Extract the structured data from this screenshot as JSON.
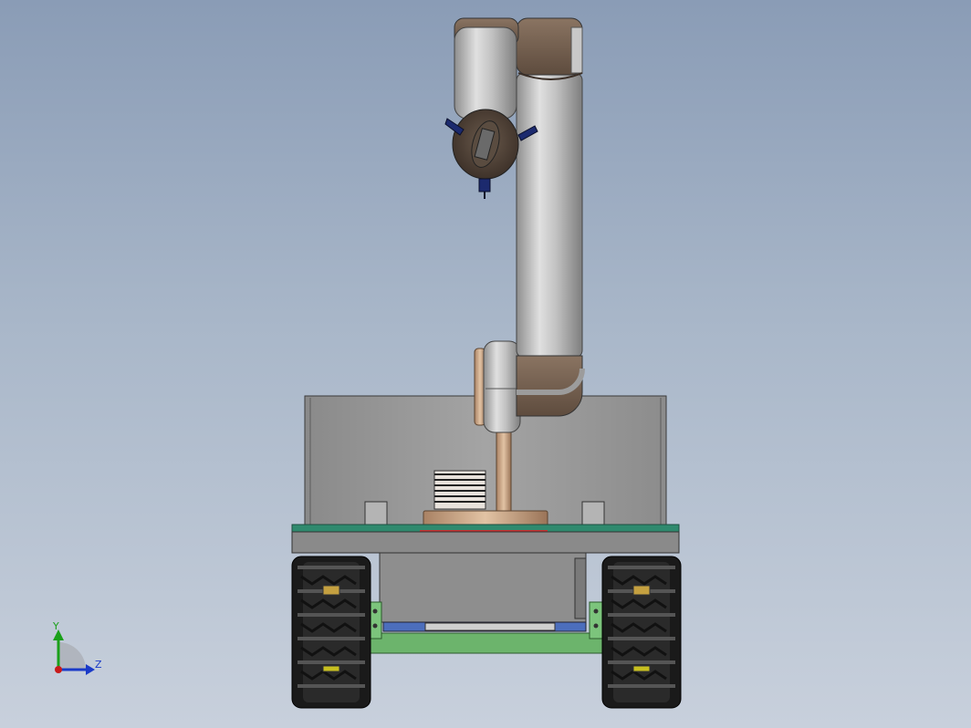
{
  "view": {
    "background_top": "#8a9cb6",
    "background_bottom": "#c8d0dc"
  },
  "model": {
    "parts": [
      "robot-arm-wrist",
      "robot-arm-upper-link",
      "robot-arm-elbow",
      "robot-arm-shoulder",
      "robot-arm-base-flange",
      "enclosure-box",
      "chassis-deck",
      "tracked-wheel-left",
      "tracked-wheel-right",
      "motor-housing",
      "chassis-frame-green"
    ],
    "colors": {
      "arm_silver": "#b8b8b8",
      "joint_brown": "#7a6656",
      "bronze": "#c4a07e",
      "enclosure_gray": "#9a9a9a",
      "deck_teal": "#2f8a6e",
      "tire_black": "#1a1a1a",
      "frame_green": "#6cb46c",
      "marker_blue": "#1c2a6e"
    }
  },
  "triad": {
    "y_label": "Y",
    "z_label": "Z",
    "y_color": "#1aa01a",
    "z_color": "#1a3ac8",
    "x_color": "#c81a1a"
  }
}
